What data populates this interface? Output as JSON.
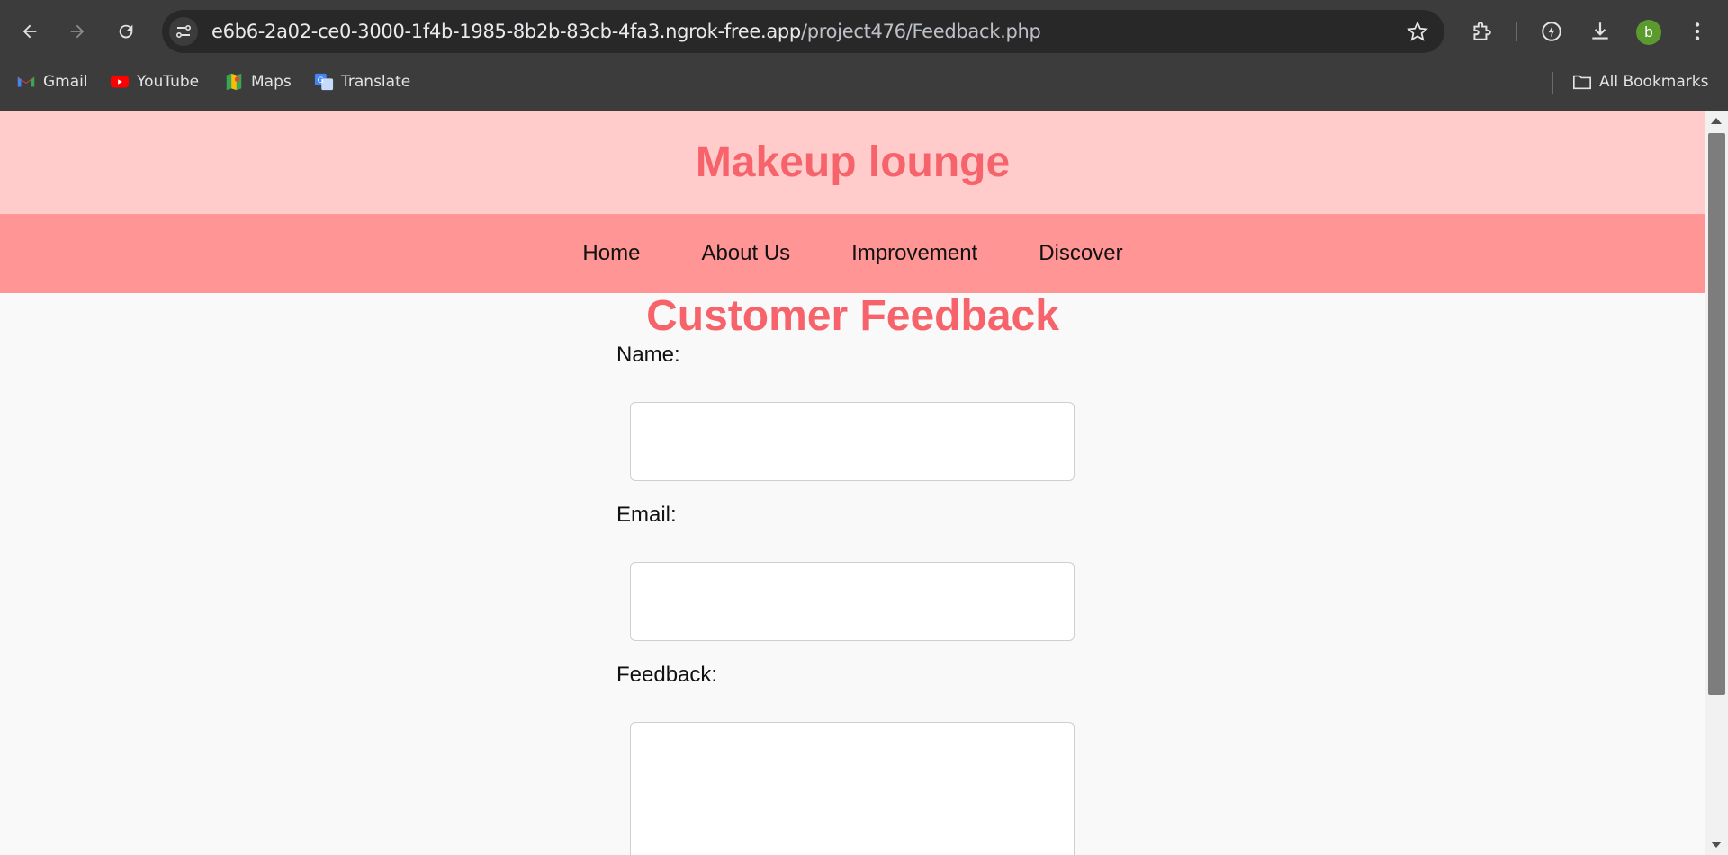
{
  "browser": {
    "url_host": "e6b6-2a02-ce0-3000-1f4b-1985-8b2b-83cb-4fa3.ngrok-free.app",
    "url_path": "/project476/Feedback.php",
    "avatar_letter": "b",
    "bookmarks": [
      {
        "label": "Gmail",
        "icon": "gmail-icon"
      },
      {
        "label": "YouTube",
        "icon": "youtube-icon"
      },
      {
        "label": "Maps",
        "icon": "maps-icon"
      },
      {
        "label": "Translate",
        "icon": "translate-icon"
      }
    ],
    "all_bookmarks_label": "All Bookmarks"
  },
  "site": {
    "title": "Makeup lounge",
    "nav": [
      "Home",
      "About Us",
      "Improvement",
      "Discover"
    ],
    "colors": {
      "header_bg": "#ffcccb",
      "nav_bg": "#ff9595",
      "accent": "#f7636b"
    }
  },
  "feedback": {
    "heading": "Customer Feedback",
    "name_label": "Name:",
    "email_label": "Email:",
    "feedback_label": "Feedback:",
    "name_value": "",
    "email_value": "",
    "feedback_value": ""
  }
}
